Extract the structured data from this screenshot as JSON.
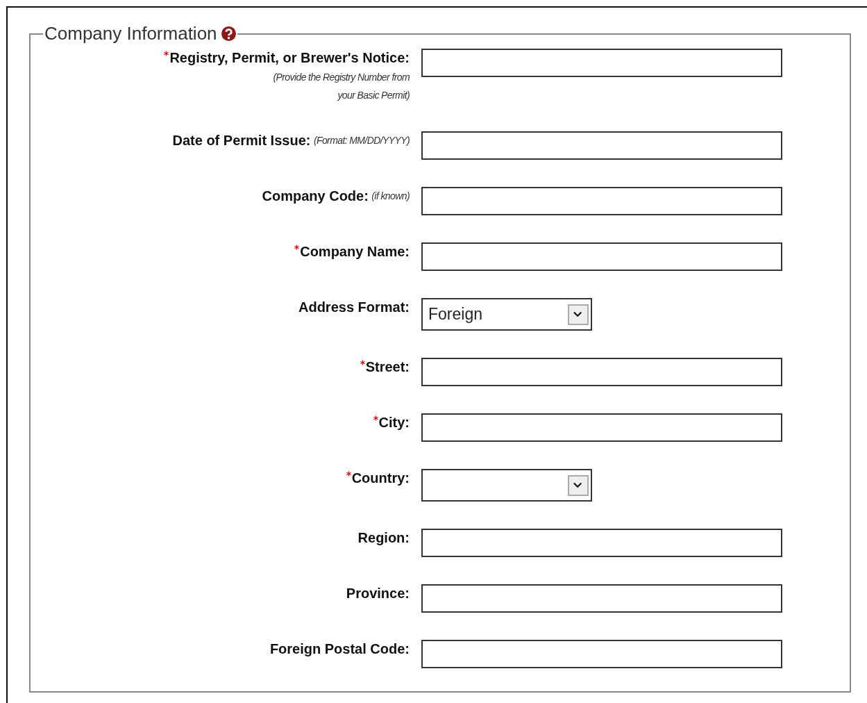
{
  "section": {
    "title": "Company Information"
  },
  "fields": [
    {
      "kind": "text",
      "label": "Registry, Permit, or Brewer's Notice:",
      "hint": "(Provide the Registry Number from your Basic Permit)",
      "required": true
    },
    {
      "kind": "text",
      "label": "Date of Permit Issue:",
      "hint": "(Format: MM/DD/YYYY)",
      "required": false
    },
    {
      "kind": "text",
      "label": "Company Code:",
      "hint": "(if known)",
      "required": false
    },
    {
      "kind": "text",
      "label": "Company Name:",
      "required": true
    },
    {
      "kind": "select",
      "label": "Address Format:",
      "required": false,
      "value": "Foreign"
    },
    {
      "kind": "text",
      "label": "Street:",
      "required": true
    },
    {
      "kind": "text",
      "label": "City:",
      "required": true
    },
    {
      "kind": "select",
      "label": "Country:",
      "required": true
    },
    {
      "kind": "text",
      "label": "Region:",
      "required": false
    },
    {
      "kind": "text",
      "label": "Province:",
      "required": false
    },
    {
      "kind": "text",
      "label": "Foreign Postal Code:",
      "required": false
    }
  ]
}
